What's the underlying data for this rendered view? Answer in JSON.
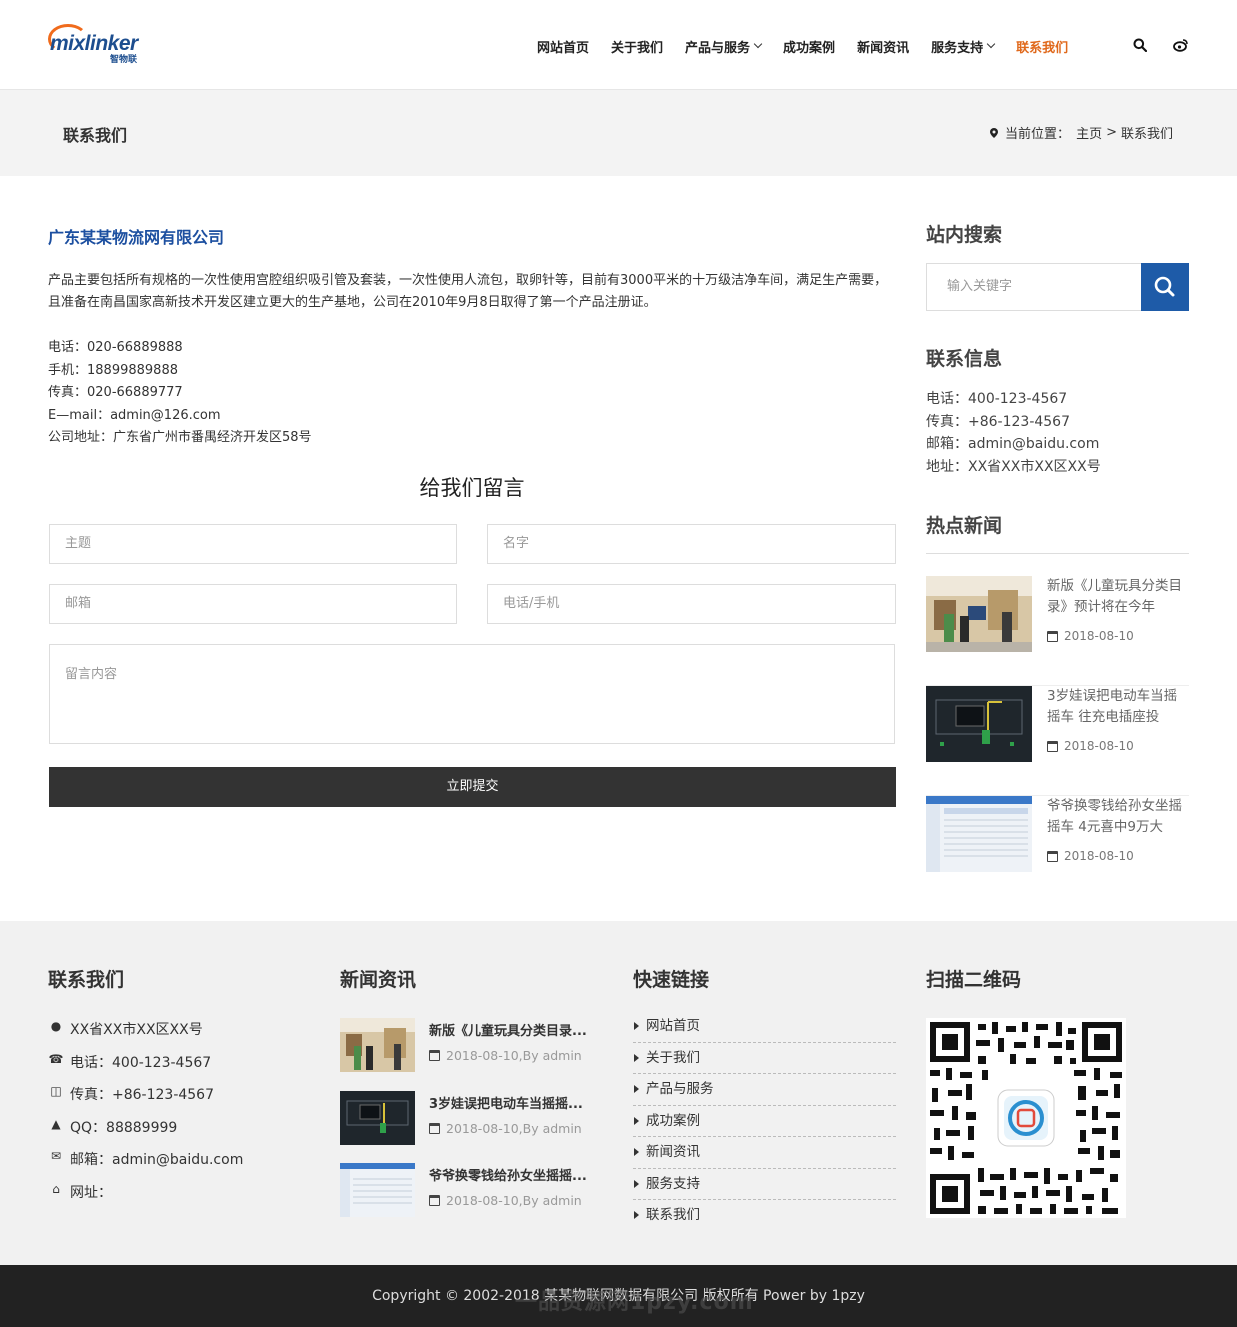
{
  "brand": {
    "logo_text": "mixlinker",
    "logo_sub": "智物联"
  },
  "nav": {
    "items": [
      {
        "label": "网站首页",
        "dropdown": false,
        "active": false
      },
      {
        "label": "关于我们",
        "dropdown": false,
        "active": false
      },
      {
        "label": "产品与服务",
        "dropdown": true,
        "active": false
      },
      {
        "label": "成功案例",
        "dropdown": false,
        "active": false
      },
      {
        "label": "新闻资讯",
        "dropdown": false,
        "active": false
      },
      {
        "label": "服务支持",
        "dropdown": true,
        "active": false
      },
      {
        "label": "联系我们",
        "dropdown": false,
        "active": true
      }
    ],
    "icons": [
      "search-icon",
      "weibo-icon"
    ],
    "accent_color": "#e0691c"
  },
  "banner": {
    "title": "联系我们",
    "crumb_prefix": "当前位置：",
    "crumb_home": "主页",
    "crumb_sep": ">",
    "crumb_current": "联系我们"
  },
  "main": {
    "company": "广东某某物流网有限公司",
    "intro": "产品主要包括所有规格的一次性使用宫腔组织吸引管及套装，一次性使用人流包，取卵针等，目前有3000平米的十万级洁净车间，满足生产需要，且准备在南昌国家高新技术开发区建立更大的生产基地，公司在2010年9月8日取得了第一个产品注册证。",
    "contacts": [
      "电话：020-66889888",
      "手机：18899889888",
      "传真：020-66889777",
      "E—mail：admin@126.com",
      "公司地址：广东省广州市番禺经济开发区58号"
    ],
    "form": {
      "title": "给我们留言",
      "subject_placeholder": "主题",
      "name_placeholder": "名字",
      "email_placeholder": "邮箱",
      "phone_placeholder": "电话/手机",
      "message_placeholder": "留言内容",
      "submit_label": "立即提交"
    }
  },
  "sidebar": {
    "search_title": "站内搜索",
    "search_placeholder": "输入关键字",
    "contact_title": "联系信息",
    "contact": [
      "电话：400-123-4567",
      "传真：+86-123-4567",
      "邮箱：admin@baidu.com",
      "地址：XX省XX市XX区XX号"
    ],
    "hot_title": "热点新闻",
    "hot_news": [
      {
        "title": "新版《儿童玩具分类目录》预计将在今年",
        "date": "2018-08-10"
      },
      {
        "title": "3岁娃误把电动车当摇摇车 往充电插座投",
        "date": "2018-08-10"
      },
      {
        "title": "爷爷换零钱给孙女坐摇摇车 4元喜中9万大",
        "date": "2018-08-10"
      }
    ],
    "brand_color": "#1e5ba8"
  },
  "footer": {
    "contact_title": "联系我们",
    "contact": [
      {
        "icon": "map-pin-icon",
        "text": "XX省XX市XX区XX号"
      },
      {
        "icon": "phone-icon",
        "text": "电话：400-123-4567"
      },
      {
        "icon": "fax-icon",
        "text": "传真：+86-123-4567"
      },
      {
        "icon": "qq-icon",
        "text": "QQ：88889999"
      },
      {
        "icon": "envelope-icon",
        "text": "邮箱：admin@baidu.com"
      },
      {
        "icon": "home-icon",
        "text": "网址："
      }
    ],
    "news_title": "新闻资讯",
    "news": [
      {
        "title": "新版《儿童玩具分类目录...",
        "meta": "2018-08-10,By admin"
      },
      {
        "title": "3岁娃误把电动车当摇摇...",
        "meta": "2018-08-10,By admin"
      },
      {
        "title": "爷爷换零钱给孙女坐摇摇...",
        "meta": "2018-08-10,By admin"
      }
    ],
    "links_title": "快速链接",
    "links": [
      "网站首页",
      "关于我们",
      "产品与服务",
      "成功案例",
      "新闻资讯",
      "服务支持",
      "联系我们"
    ],
    "qr_title": "扫描二维码",
    "copyright": "Copyright © 2002-2018 某某物联网数据有限公司 版权所有 Power by 1pzy",
    "watermark": "一品资源网1pzy.com"
  }
}
